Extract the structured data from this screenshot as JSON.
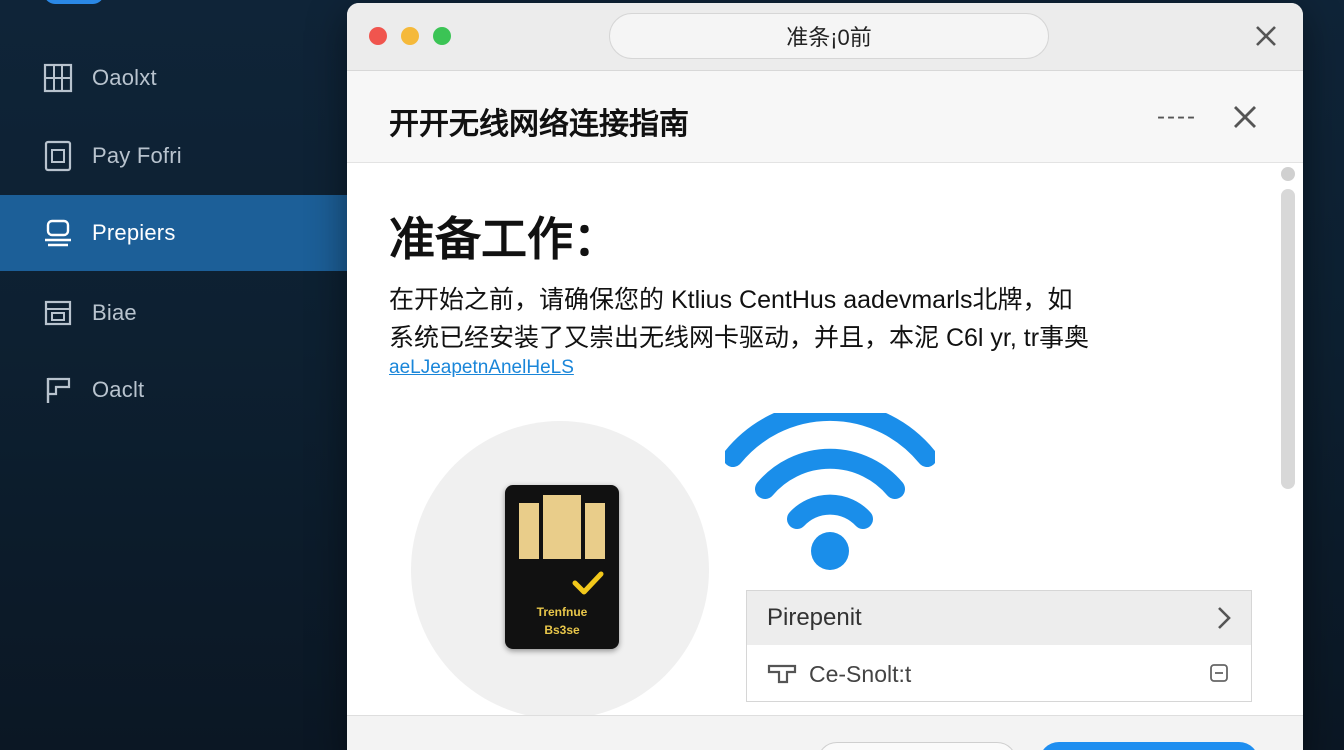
{
  "sidebar": {
    "items": [
      {
        "label": "Oaolxt",
        "icon": "grid-icon"
      },
      {
        "label": "Pay Fofri",
        "icon": "document-icon"
      },
      {
        "label": "Prepiers",
        "icon": "device-icon",
        "active": true
      },
      {
        "label": "Biae",
        "icon": "tray-icon"
      },
      {
        "label": "Oaclt",
        "icon": "flag-icon"
      }
    ]
  },
  "window": {
    "titlebar": {
      "title": "准条¡0前"
    },
    "header": {
      "title": "开开无线网络连接指南",
      "minimize_label": "----"
    },
    "content": {
      "heading": "准备工作：",
      "paragraph_line1": "在开始之前，请确保您的 Ktlius CentHus aadevmarls北牌，如",
      "paragraph_line2": "系统已经安装了又崇出无线网卡驱动，并且，本泥 C6l yr, tr事奥",
      "link": "aeLJeapetnAnelHeLS",
      "card": {
        "label_line1": "Trenfnue",
        "label_line2": "Bs3se"
      },
      "panel": {
        "row1_label": "Pirepenit",
        "row2_label": "Ce-Snolt:t"
      }
    }
  },
  "colors": {
    "accent": "#1e8ef0",
    "sidebar_active": "#1c5f98",
    "wifi": "#1a8eea",
    "check": "#f2c81b"
  }
}
